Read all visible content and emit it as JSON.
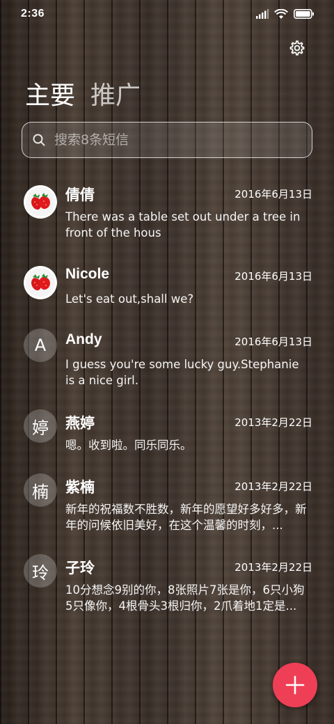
{
  "status_bar": {
    "time": "2:36"
  },
  "tabs": [
    {
      "label": "主要"
    },
    {
      "label": "推广"
    }
  ],
  "search": {
    "placeholder": "搜索8条短信"
  },
  "conversations": [
    {
      "name": "倩倩",
      "date": "2016年6月13日",
      "preview": "There was a table set out under a tree in front of the hous",
      "avatar": "strawberry-photo"
    },
    {
      "name": "Nicole",
      "date": "2016年6月13日",
      "preview": "Let's eat out,shall we?",
      "avatar": "strawberry-photo"
    },
    {
      "name": "Andy",
      "date": "2016年6月13日",
      "preview": "I guess you're some lucky guy.Stephanie is a nice girl.",
      "avatar_letter": "A"
    },
    {
      "name": "燕婷",
      "date": "2013年2月22日",
      "preview": "嗯。收到啦。同乐同乐。",
      "avatar_letter": "婷"
    },
    {
      "name": "紫楠",
      "date": "2013年2月22日",
      "preview": "新年的祝福数不胜数，新年的愿望好多好多，新年的问候依旧美好，在这个温馨的时刻，...",
      "avatar_letter": "楠"
    },
    {
      "name": "子玲",
      "date": "2013年2月22日",
      "preview": "10分想念9别的你，8张照片7张是你，6只小狗5只像你，4根骨头3根归你，2爪着地1定是...",
      "avatar_letter": "玲"
    }
  ],
  "fab": {
    "icon": "plus-icon"
  },
  "colors": {
    "fab": "#ef3f56"
  }
}
